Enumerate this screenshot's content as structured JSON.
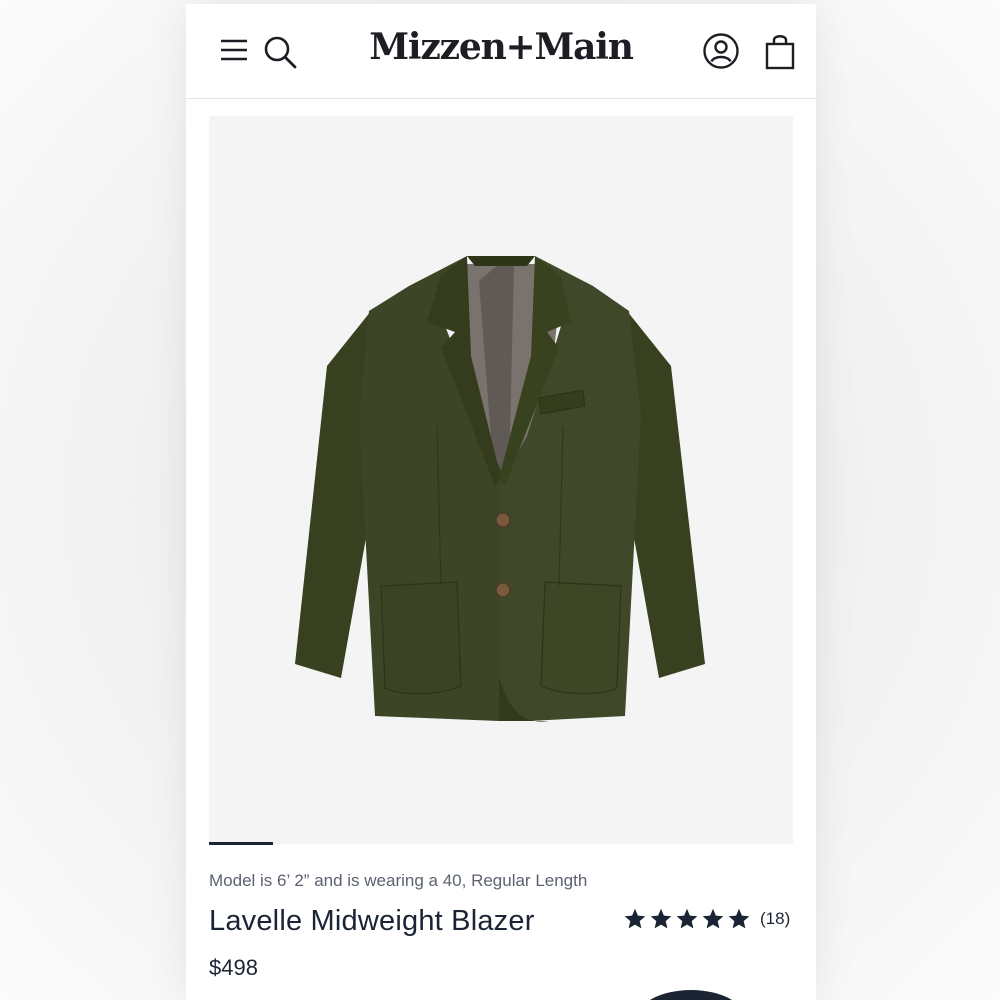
{
  "brand": {
    "logo_text": "Mizzen+Main"
  },
  "header": {
    "icons": [
      "menu-icon",
      "search-icon",
      "account-icon",
      "shopping-bag-icon"
    ]
  },
  "product": {
    "model_note": "Model is 6’ 2” and is wearing a 40, Regular Length",
    "title": "Lavelle Midweight Blazer",
    "rating": {
      "stars": 5,
      "max_stars": 5,
      "count_label": "(18)"
    },
    "price": "$498",
    "image": {
      "subject": "blazer",
      "color": "#3c4526"
    },
    "gallery": {
      "current_slide": 1
    }
  },
  "colors": {
    "text_primary": "#1b2434",
    "text_secondary": "#5b6270",
    "logo": "#1d1d24",
    "image_bg": "#f4f4f4",
    "blazer_green": "#3c4526"
  }
}
